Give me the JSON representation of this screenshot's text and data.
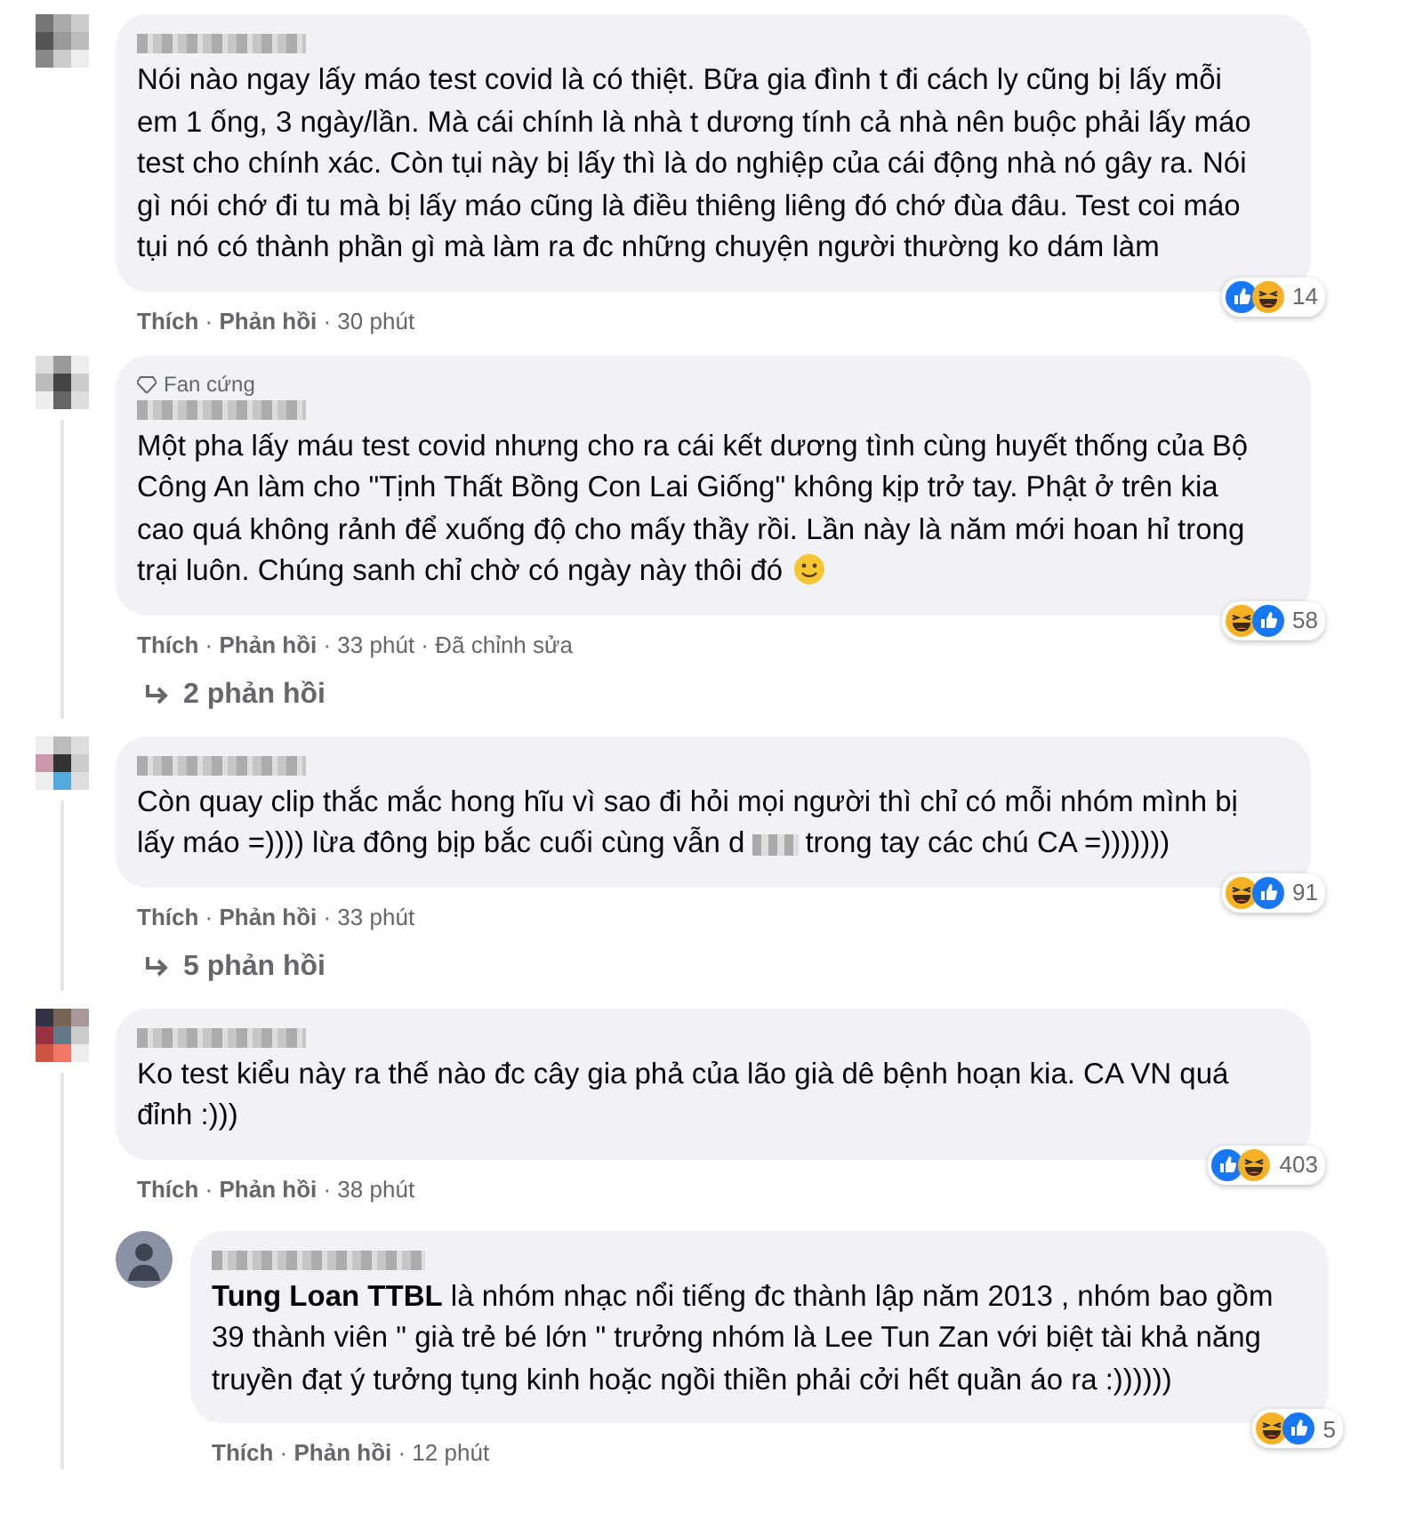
{
  "comments": [
    {
      "name_redacted": true,
      "text": "Nói nào ngay lấy máo test covid là có thiệt. Bữa gia đình t đi cách ly cũng bị lấy mỗi em 1 ống, 3 ngày/lần. Mà cái chính là nhà t dương tính cả nhà nên buộc phải lấy máo test cho chính xác. Còn tụi này bị lấy thì là do nghiệp của cái động nhà nó gây ra. Nói gì nói chớ đi tu mà bị lấy máo cũng là điều thiêng liêng đó chớ đùa đâu. Test coi máo tụi nó có thành phần gì mà làm ra đc những chuyện người thường ko dám làm",
      "meta": "**Thích** · **Phản hồi** · 30 phút",
      "reactions": [
        {
          "kind": "like"
        },
        {
          "kind": "haha"
        }
      ],
      "reaction_count": "14"
    },
    {
      "badge": "Fan cứng",
      "name_redacted": true,
      "text": "Một pha lấy máu test covid nhưng cho ra cái kết dương tình cùng huyết thống của Bộ Công An làm cho \"Tịnh Thất Bồng Con Lai Giống\" không kịp trở tay. Phật ở trên kia cao quá không rảnh để xuống độ cho mấy thầy rồi. Lần này là năm mới hoan hỉ trong trại luôn. Chúng sanh chỉ chờ có ngày này thôi đó",
      "emoji": true,
      "meta": "**Thích** · **Phản hồi** · 33 phút · Đã chỉnh sửa",
      "reactions": [
        {
          "kind": "haha"
        },
        {
          "kind": "like"
        }
      ],
      "reaction_count": "58",
      "replies_link": "2 phản hồi"
    },
    {
      "name_redacted": true,
      "text": "Còn quay clip thắc mắc hong hĩu vì sao đi hỏi mọi người thì chỉ có mỗi nhóm mình bị lấy máo =)))) lừa đông bịp bắc cuối cùng vẫn d",
      "text_after": "trong tay các chú CA =)))))))",
      "meta": "**Thích** · **Phản hồi** · 33 phút",
      "reactions": [
        {
          "kind": "haha"
        },
        {
          "kind": "like"
        }
      ],
      "reaction_count": "91",
      "replies_link": "5 phản hồi"
    },
    {
      "name_redacted": true,
      "text": "Ko test kiểu này ra thế nào đc cây gia phả của lão già dê bệnh hoạn kia. CA VN quá đỉnh :)))",
      "meta": "**Thích** · **Phản hồi** · 38 phút",
      "reactions": [
        {
          "kind": "like"
        },
        {
          "kind": "haha"
        }
      ],
      "reaction_count": "403",
      "replies": [
        {
          "name_redacted": true,
          "text": "**Tung Loan TTBL** là nhóm nhạc nổi tiếng đc thành lập năm 2013 , nhóm bao gồm 39 thành viên \" già trẻ bé lớn \" trưởng nhóm là Lee Tun Zan với biệt tài khả năng truyền đạt ý tưởng tụng kinh hoặc ngồi thiền phải cởi hết quần áo ra :))))))",
          "meta": "**Thích** · **Phản hồi** · 12 phút",
          "reactions": [
            {
              "kind": "haha"
            },
            {
              "kind": "like"
            }
          ],
          "reaction_count": "5"
        }
      ]
    }
  ]
}
